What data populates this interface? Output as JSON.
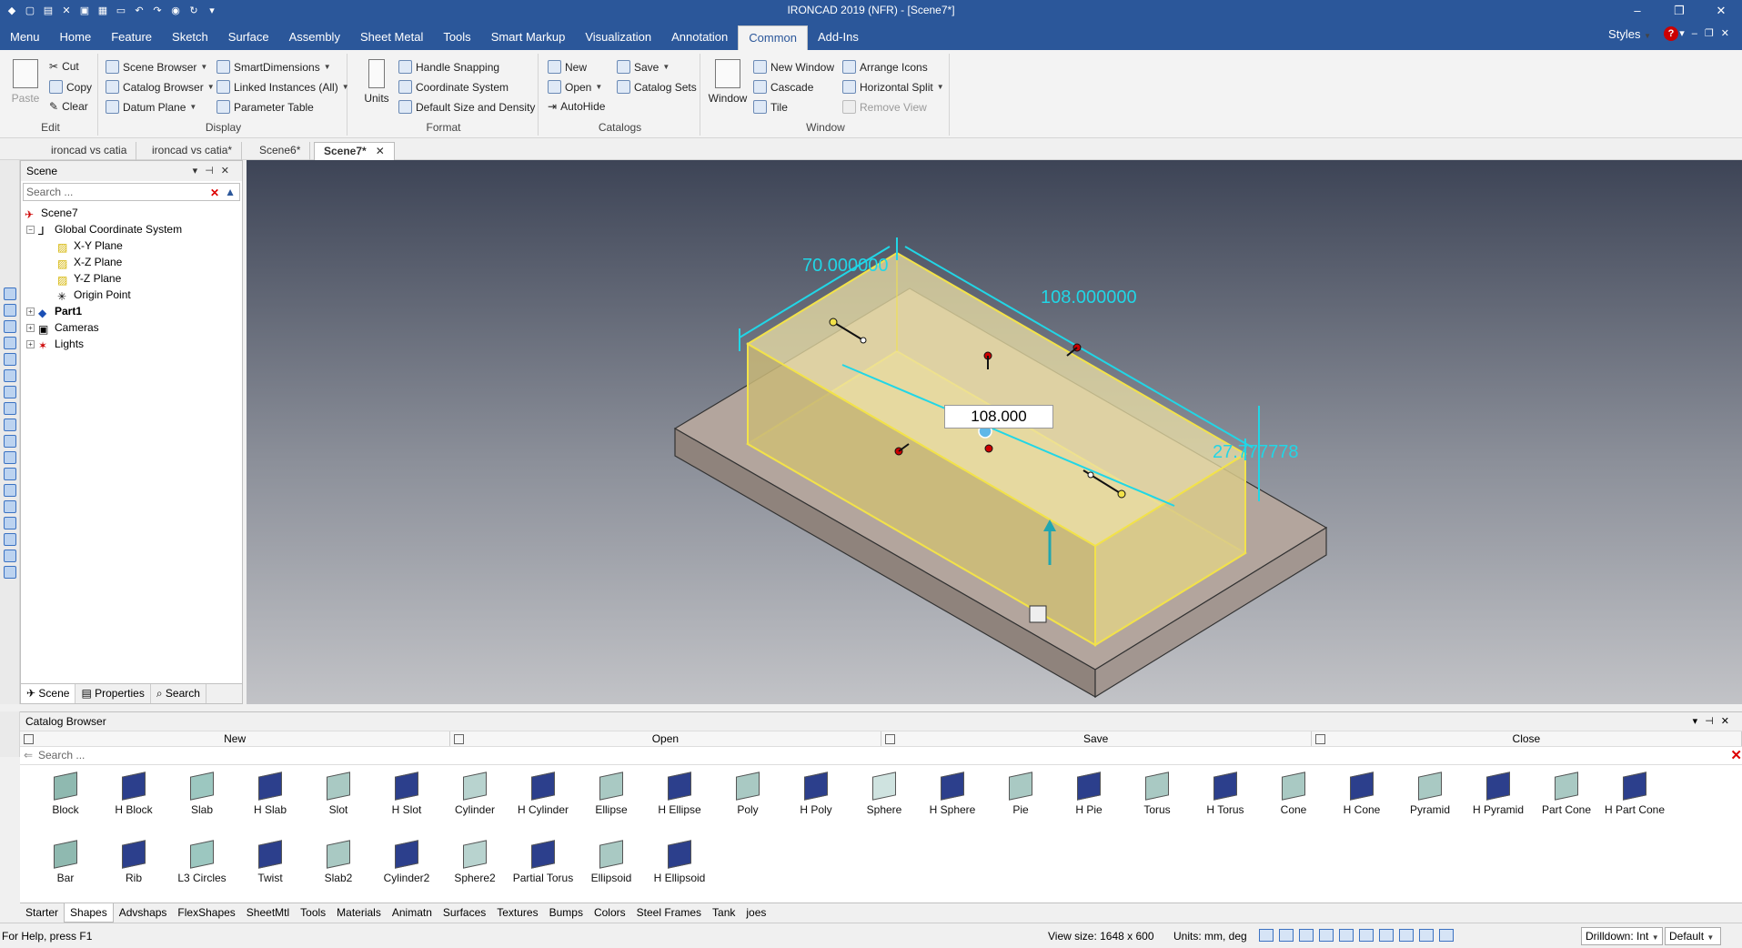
{
  "app": {
    "title": "IRONCAD 2019 (NFR) - [Scene7*]",
    "styles_label": "Styles",
    "help_label": "?"
  },
  "menu": {
    "tabs": [
      "Menu",
      "Home",
      "Feature",
      "Sketch",
      "Surface",
      "Assembly",
      "Sheet Metal",
      "Tools",
      "Smart Markup",
      "Visualization",
      "Annotation",
      "Common",
      "Add-Ins"
    ],
    "active": "Common"
  },
  "ribbon": {
    "edit": {
      "label": "Edit",
      "paste": "Paste",
      "cut": "Cut",
      "copy": "Copy",
      "clear": "Clear"
    },
    "display": {
      "label": "Display",
      "scene_browser": "Scene Browser",
      "catalog_browser": "Catalog Browser",
      "datum_plane": "Datum Plane",
      "smart_dimensions": "SmartDimensions",
      "linked_instances": "Linked Instances (All)",
      "parameter_table": "Parameter Table"
    },
    "format": {
      "label": "Format",
      "units": "Units",
      "handle_snapping": "Handle Snapping",
      "coordinate_system": "Coordinate System",
      "default_size": "Default Size and Density"
    },
    "catalogs": {
      "label": "Catalogs",
      "new": "New",
      "open": "Open",
      "autohide": "AutoHide",
      "save": "Save",
      "catalog_sets": "Catalog Sets"
    },
    "window": {
      "label": "Window",
      "window": "Window",
      "new_window": "New Window",
      "cascade": "Cascade",
      "tile": "Tile",
      "arrange_icons": "Arrange Icons",
      "horizontal_split": "Horizontal Split",
      "remove_view": "Remove View"
    }
  },
  "doc_tabs": [
    {
      "label": "ironcad vs catia"
    },
    {
      "label": "ironcad vs catia*"
    },
    {
      "label": "Scene6*"
    },
    {
      "label": "Scene7*"
    }
  ],
  "scene_panel": {
    "title": "Scene",
    "search_placeholder": "Search ...",
    "tree": {
      "root": "Scene7",
      "gcs": "Global Coordinate System",
      "xy": "X-Y Plane",
      "xz": "X-Z Plane",
      "yz": "Y-Z Plane",
      "origin": "Origin Point",
      "part": "Part1",
      "cameras": "Cameras",
      "lights": "Lights"
    },
    "tabs": {
      "scene": "Scene",
      "properties": "Properties",
      "search": "Search"
    }
  },
  "viewport": {
    "dim_length_edit": "108.000",
    "dim_width": "70.000000",
    "dim_length": "108.000000",
    "dim_height": "27.777778"
  },
  "catalog": {
    "title": "Catalog Browser",
    "buttons": {
      "new": "New",
      "open": "Open",
      "save": "Save",
      "close": "Close"
    },
    "search_placeholder": "Search ...",
    "shapes_row1": [
      "Block",
      "H Block",
      "Slab",
      "H Slab",
      "Slot",
      "H Slot",
      "Cylinder",
      "H Cylinder",
      "Ellipse",
      "H Ellipse",
      "Poly",
      "H Poly",
      "Sphere",
      "H Sphere",
      "Pie",
      "H Pie",
      "Torus",
      "H Torus",
      "Cone",
      "H Cone",
      "Pyramid",
      "H Pyramid",
      "Part Cone",
      "H Part Cone"
    ],
    "shapes_row2": [
      "Bar",
      "Rib",
      "L3 Circles",
      "Twist",
      "Slab2",
      "Cylinder2",
      "Sphere2",
      "Partial Torus",
      "Ellipsoid",
      "H Ellipsoid"
    ],
    "tabs": [
      "Starter",
      "Shapes",
      "Advshaps",
      "FlexShapes",
      "SheetMtl",
      "Tools",
      "Materials",
      "Animatn",
      "Surfaces",
      "Textures",
      "Bumps",
      "Colors",
      "Steel Frames",
      "Tank",
      "joes"
    ],
    "active_tab": "Shapes"
  },
  "status": {
    "help": "For Help, press F1",
    "view_size": "View size: 1648 x 600",
    "units": "Units: mm, deg",
    "drilldown": "Drilldown: Int",
    "default": "Default"
  },
  "colors": {
    "accent": "#2b579a",
    "dimension": "#21d6e6",
    "selection": "#f2e24a"
  }
}
